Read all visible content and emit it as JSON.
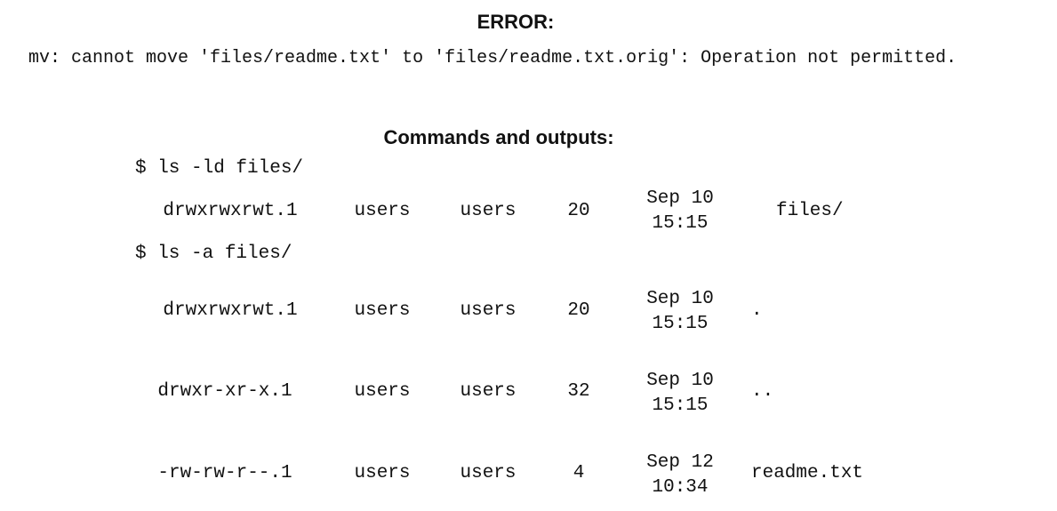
{
  "error": {
    "title": "ERROR:",
    "message": "mv: cannot move 'files/readme.txt' to 'files/readme.txt.orig': Operation not permitted."
  },
  "commands": {
    "title": "Commands and outputs:",
    "cmd1": "$ ls -ld files/",
    "cmd2": "$ ls -a files/",
    "rows": [
      {
        "perms": "drwxrwxrwt.1",
        "user": "users",
        "group": "users",
        "size": "20",
        "date": "Sep 10",
        "time": "15:15",
        "name": "files/"
      },
      {
        "perms": "drwxrwxrwt.1",
        "user": "users",
        "group": "users",
        "size": "20",
        "date": "Sep 10",
        "time": "15:15",
        "name": "."
      },
      {
        "perms": "drwxr-xr-x.1",
        "user": "users",
        "group": "users",
        "size": "32",
        "date": "Sep 10",
        "time": "15:15",
        "name": ".."
      },
      {
        "perms": "-rw-rw-r--.1",
        "user": "users",
        "group": "users",
        "size": "4",
        "date": "Sep 12",
        "time": "10:34",
        "name": "readme.txt"
      }
    ]
  }
}
